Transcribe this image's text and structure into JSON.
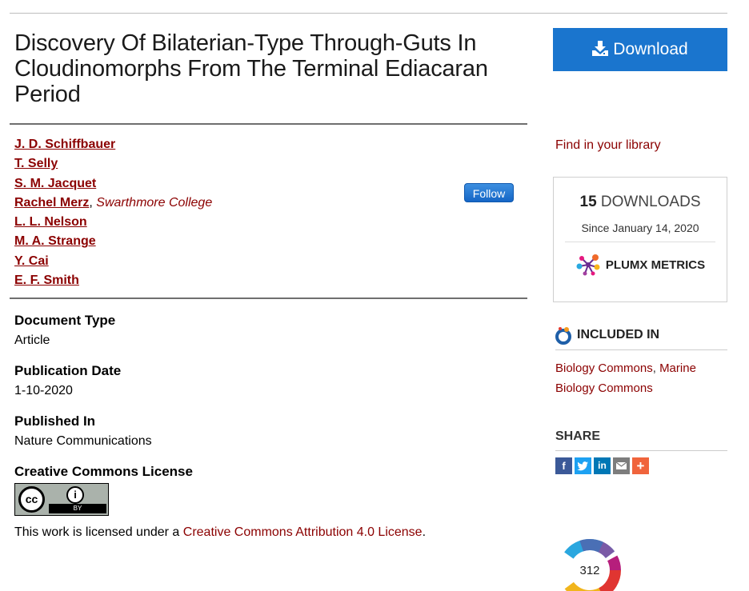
{
  "title": "Discovery Of Bilaterian-Type Through-Guts In Cloudinomorphs From The Terminal Ediacaran Period",
  "authors": [
    {
      "name": "J. D. Schiffbauer",
      "affiliation": ""
    },
    {
      "name": "T. Selly",
      "affiliation": ""
    },
    {
      "name": "S. M. Jacquet",
      "affiliation": ""
    },
    {
      "name": "Rachel Merz",
      "affiliation": "Swarthmore College"
    },
    {
      "name": "L. L. Nelson",
      "affiliation": ""
    },
    {
      "name": "M. A. Strange",
      "affiliation": ""
    },
    {
      "name": "Y. Cai",
      "affiliation": ""
    },
    {
      "name": "E. F. Smith",
      "affiliation": ""
    }
  ],
  "follow_label": "Follow",
  "metadata": [
    {
      "label": "Document Type",
      "value": "Article"
    },
    {
      "label": "Publication Date",
      "value": "1-10-2020"
    },
    {
      "label": "Published In",
      "value": "Nature Communications"
    }
  ],
  "license": {
    "label": "Creative Commons License",
    "badge_cc": "cc",
    "badge_by": "BY",
    "text_before": "This work is licensed under a ",
    "link_text": "Creative Commons Attribution 4.0 License",
    "text_after": "."
  },
  "sidebar": {
    "download_label": "Download",
    "find_library": "Find in your library",
    "downloads_count": "15",
    "downloads_label": "DOWNLOADS",
    "since": "Since January 14, 2020",
    "plumx_label": "PLUMX METRICS",
    "included_in_label": "INCLUDED IN",
    "included_link_1": "Biology Commons",
    "included_sep": ", ",
    "included_link_2": "Marine Biology Commons",
    "share_label": "SHARE",
    "share_icons": [
      "facebook-icon",
      "twitter-icon",
      "linkedin-icon",
      "email-icon",
      "more-icon"
    ],
    "altmetric_score": "312"
  }
}
